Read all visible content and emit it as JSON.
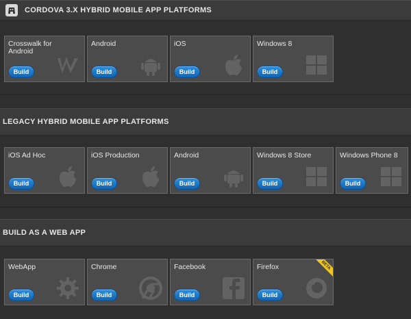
{
  "sections": [
    {
      "title": "CORDOVA 3.X HYBRID MOBILE APP PLATFORMS",
      "tiles": [
        {
          "label": "Crosswalk for Android",
          "button": "Build",
          "icon": "crosswalk-icon"
        },
        {
          "label": "Android",
          "button": "Build",
          "icon": "android-icon"
        },
        {
          "label": "iOS",
          "button": "Build",
          "icon": "apple-icon"
        },
        {
          "label": "Windows 8",
          "button": "Build",
          "icon": "windows-icon"
        }
      ]
    },
    {
      "title": "LEGACY HYBRID MOBILE APP PLATFORMS",
      "tiles": [
        {
          "label": "iOS Ad Hoc",
          "button": "Build",
          "icon": "apple-icon"
        },
        {
          "label": "iOS Production",
          "button": "Build",
          "icon": "apple-icon"
        },
        {
          "label": "Android",
          "button": "Build",
          "icon": "android-icon"
        },
        {
          "label": "Windows 8 Store",
          "button": "Build",
          "icon": "windows-icon"
        },
        {
          "label": "Windows Phone 8",
          "button": "Build",
          "icon": "windows-icon"
        }
      ]
    },
    {
      "title": "BUILD AS A WEB APP",
      "tiles": [
        {
          "label": "WebApp",
          "button": "Build",
          "icon": "gear-icon"
        },
        {
          "label": "Chrome",
          "button": "Build",
          "icon": "chrome-icon"
        },
        {
          "label": "Facebook",
          "button": "Build",
          "icon": "facebook-icon"
        },
        {
          "label": "Firefox",
          "button": "Build",
          "icon": "firefox-icon",
          "badge": "BETA"
        }
      ]
    }
  ],
  "colors": {
    "accent": "#1a73c2",
    "beta": "#f0c419"
  }
}
